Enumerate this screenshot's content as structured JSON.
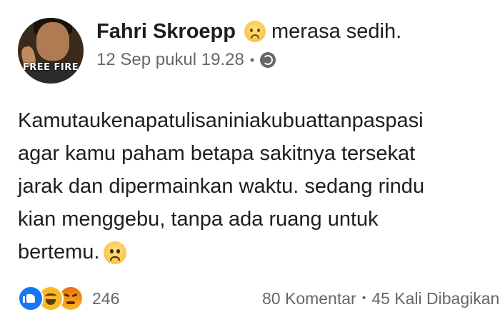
{
  "post": {
    "author_name": "Fahri Skroepp",
    "feeling_text": "merasa sedih.",
    "feeling_icon": "sad-face-icon",
    "timestamp": "12 Sep pukul 19.28",
    "meta_separator": "•",
    "privacy_icon": "globe-icon",
    "avatar_logo_text": "FREE FIRE",
    "text_lines": [
      "Kamutaukenapatulisaniniakubuattanpaspasi",
      "agar kamu paham betapa sakitnya tersekat",
      "jarak dan dipermainkan waktu. sedang rindu",
      "kian menggebu, tanpa ada ruang untuk",
      "bertemu."
    ],
    "end_emoji": "frowning-face-icon"
  },
  "footer": {
    "reaction_icons": [
      "like-icon",
      "haha-icon",
      "angry-icon"
    ],
    "reaction_count": "246",
    "comments": "80 Komentar",
    "separator": "•",
    "shares": "45 Kali Dibagikan"
  },
  "colors": {
    "text": "#1c1e21",
    "secondary": "#65676b",
    "like_blue": "#1877f2",
    "emoji_yellow": "#f7b928"
  }
}
